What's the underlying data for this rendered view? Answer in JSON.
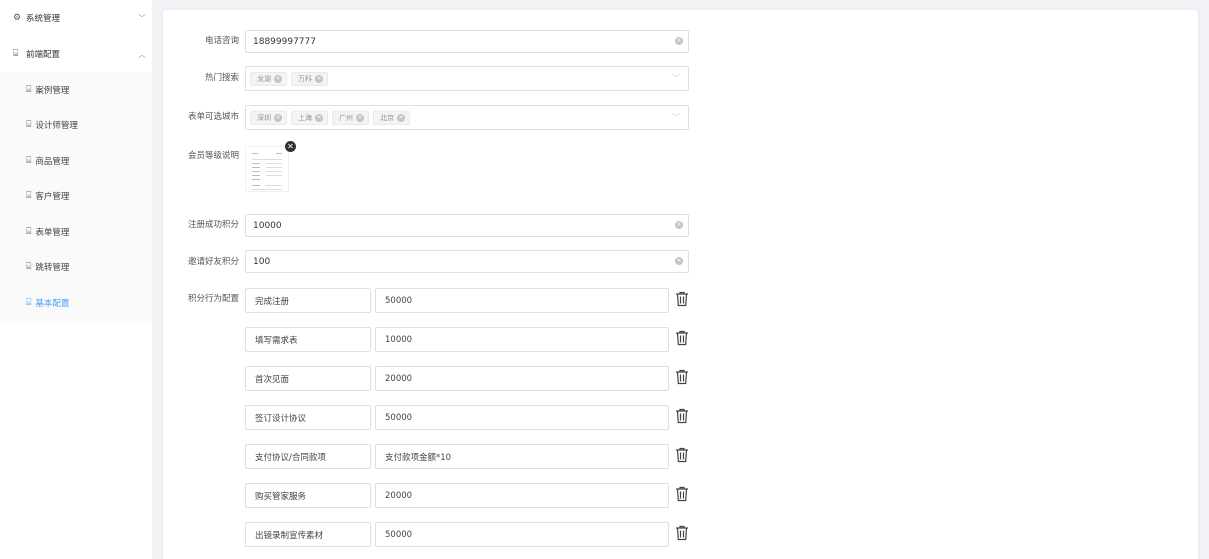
{
  "sidebar": {
    "groups": [
      {
        "label": "系统管理",
        "icon": "gear-icon",
        "chevron": "down"
      },
      {
        "label": "前端配置",
        "icon": "map-icon",
        "chevron": "up"
      }
    ],
    "items": [
      {
        "label": "案例管理",
        "icon": "map-icon"
      },
      {
        "label": "设计师管理",
        "icon": "map-icon"
      },
      {
        "label": "商品管理",
        "icon": "map-icon"
      },
      {
        "label": "客户管理",
        "icon": "map-icon"
      },
      {
        "label": "表单管理",
        "icon": "map-icon"
      },
      {
        "label": "跳转管理",
        "icon": "map-icon"
      },
      {
        "label": "基本配置",
        "icon": "map-icon",
        "active": true
      }
    ]
  },
  "form": {
    "phone": {
      "label": "电话咨询",
      "value": "18899997777"
    },
    "hot_search": {
      "label": "热门搜索",
      "tags": [
        "龙湖",
        "万科"
      ]
    },
    "cities": {
      "label": "表单可选城市",
      "tags": [
        "深圳",
        "上海",
        "广州",
        "北京"
      ]
    },
    "member_level": {
      "label": "会员等级说明"
    },
    "register_points": {
      "label": "注册成功积分",
      "value": "10000"
    },
    "invite_points": {
      "label": "邀请好友积分",
      "value": "100"
    },
    "rules_label": "积分行为配置",
    "rules": [
      {
        "name": "完成注册",
        "value": "50000"
      },
      {
        "name": "填写需求表",
        "value": "10000"
      },
      {
        "name": "首次见面",
        "value": "20000"
      },
      {
        "name": "签订设计协议",
        "value": "50000"
      },
      {
        "name": "支付协议/合同款项",
        "value": "支付款项金额*10"
      },
      {
        "name": "购买管家服务",
        "value": "20000"
      },
      {
        "name": "出镜录制宣传素材",
        "value": "50000"
      }
    ]
  },
  "colors": {
    "accent": "#409eff",
    "border": "#dcdfe6",
    "tag_bg": "#f4f4f5"
  }
}
